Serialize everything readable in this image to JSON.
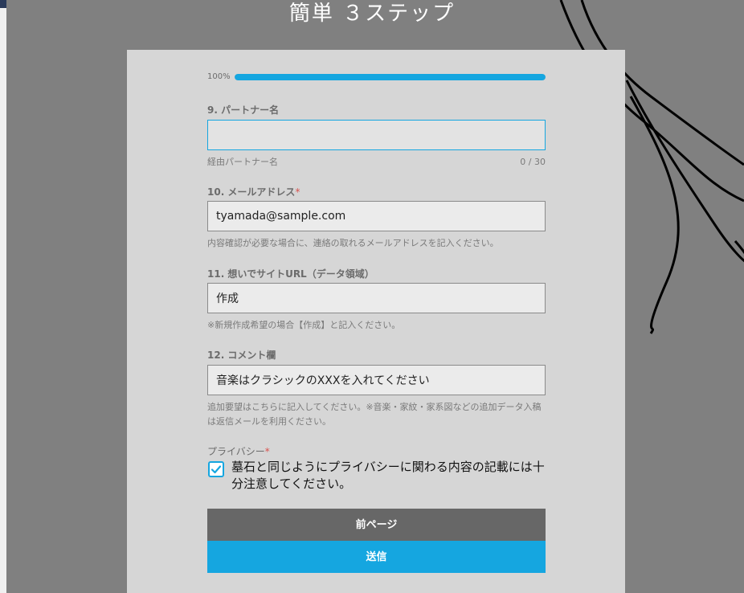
{
  "header": {
    "title": "簡単 ３ステップ"
  },
  "progress": {
    "label": "100%",
    "fraction": 1.0
  },
  "fields": [
    {
      "number_label": "9. パートナー名",
      "required": false,
      "value": "",
      "help": "経由パートナー名",
      "counter": "0 / 30"
    },
    {
      "number_label": "10. メールアドレス",
      "required": true,
      "value": "tyamada@sample.com",
      "help": "内容確認が必要な場合に、連絡の取れるメールアドレスを記入ください。"
    },
    {
      "number_label": "11. 想いでサイトURL（データ領域）",
      "required": false,
      "value": "作成",
      "help": "※新規作成希望の場合【作成】と記入ください。"
    },
    {
      "number_label": "12. コメント欄",
      "required": false,
      "value": "音楽はクラシックのXXXを入れてください",
      "help": "追加要望はこちらに記入してください。※音楽・家紋・家系図などの追加データ入稿は返信メールを利用ください。"
    }
  ],
  "privacy": {
    "label": "プライバシー",
    "required_mark": "*",
    "checked": true,
    "consent_text": "墓石と同じようにプライバシーに関わる内容の記載には十分注意してください。"
  },
  "buttons": {
    "prev_label": "前ページ",
    "submit_label": "送信"
  },
  "colors": {
    "accent": "#15a6e0",
    "prev_button": "#676767",
    "card": "#d6d6d6",
    "backdrop": "#808080"
  }
}
